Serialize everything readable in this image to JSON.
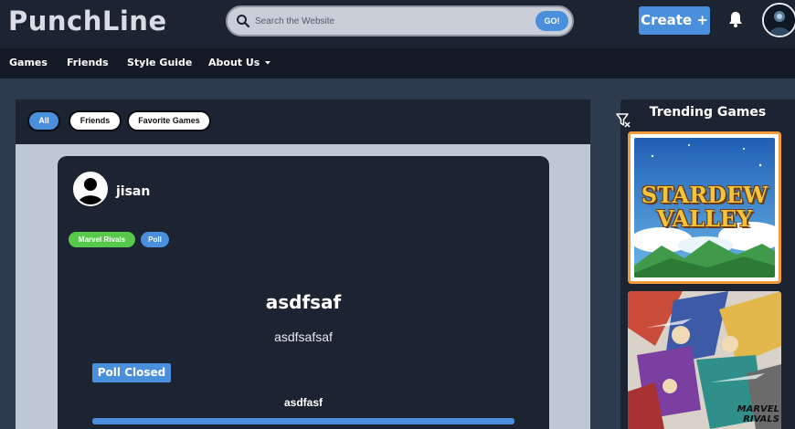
{
  "header": {
    "logo": "PunchLine",
    "search": {
      "placeholder": "Search the Website",
      "button": "GO!"
    },
    "create_label": "Create +"
  },
  "nav": {
    "items": [
      "Games",
      "Friends",
      "Style Guide",
      "About Us"
    ]
  },
  "feed": {
    "filters": [
      {
        "label": "All",
        "active": true
      },
      {
        "label": "Friends",
        "active": false
      },
      {
        "label": "Favorite Games",
        "active": false
      }
    ],
    "post": {
      "username": "jisan",
      "tags": [
        "Marvel Rivals",
        "Poll"
      ],
      "title": "asdfsaf",
      "body": "asdfsafsaf",
      "poll_status": "Poll Closed",
      "poll_option": "asdfasf",
      "poll_option_share": 1.0
    }
  },
  "trending": {
    "title": "Trending Games",
    "games": [
      {
        "name_lines": [
          "STARDEW",
          "VALLEY"
        ]
      },
      {
        "name": "MARVEL RIVALS"
      }
    ]
  },
  "colors": {
    "accent": "#4a8fdb",
    "tag_green": "#56c94b",
    "highlight_border": "#f29b3a",
    "panel": "#1c2331"
  }
}
